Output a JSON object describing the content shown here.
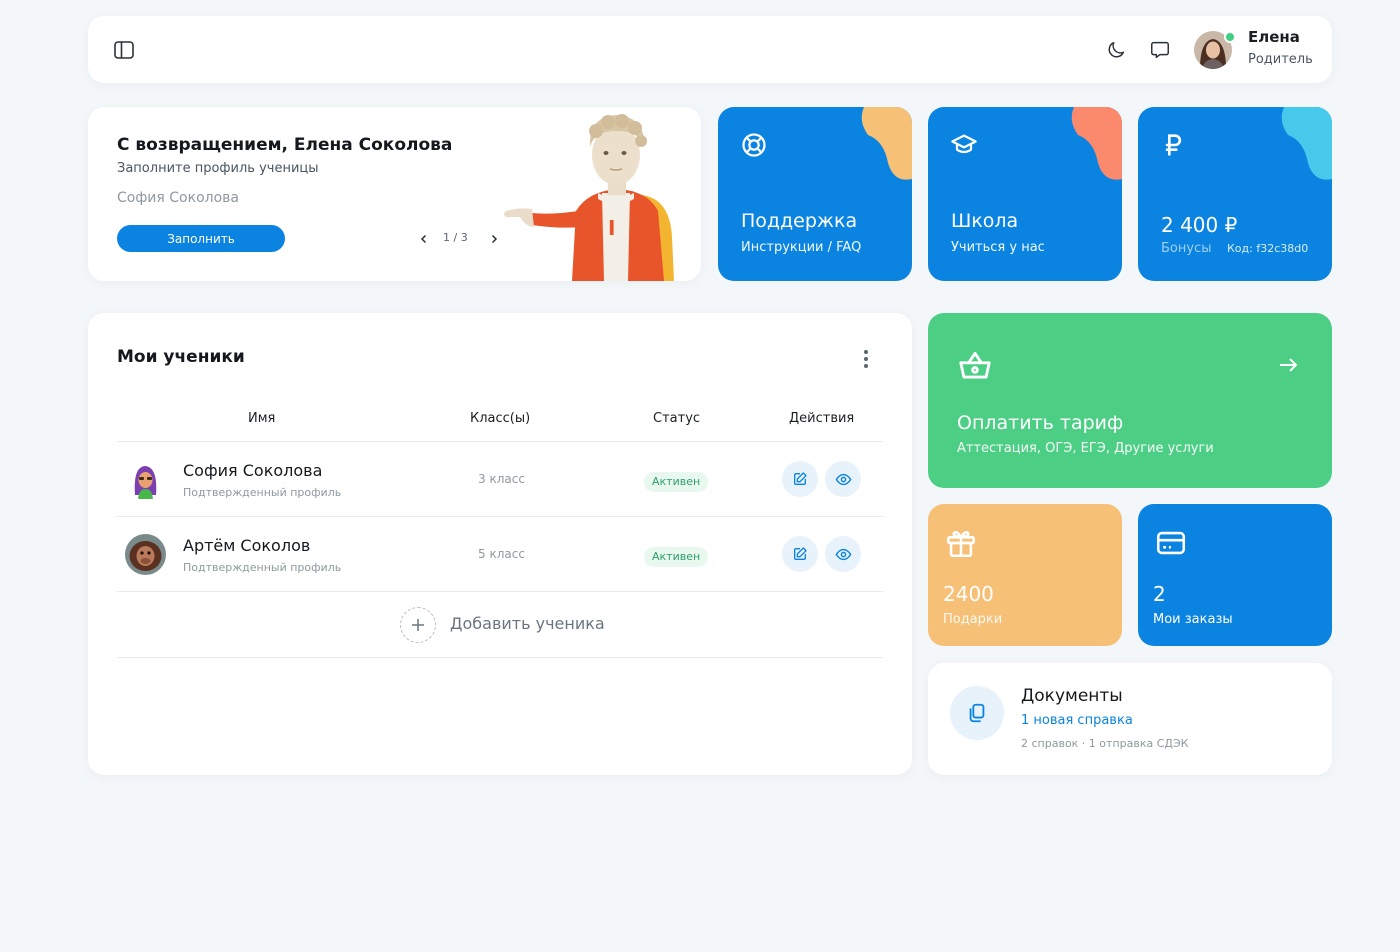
{
  "colors": {
    "primary": "#0a84e0",
    "green": "#4ccf84",
    "orange": "#f6c076",
    "online": "#3ecf7f"
  },
  "header": {
    "user_name": "Елена",
    "user_role": "Родитель",
    "icons": [
      "sidebar-toggle-icon",
      "moon-icon",
      "chat-icon"
    ]
  },
  "welcome": {
    "title": "С возвращением, Елена Соколова",
    "subtitle": "Заполните профиль ученицы",
    "student_name": "София Соколова",
    "fill_button": "Заполнить",
    "counter": "1 / 3"
  },
  "tiles": {
    "support": {
      "title": "Поддержка",
      "subtitle": "Инструкции / FAQ",
      "icon": "lifebuoy-icon"
    },
    "school": {
      "title": "Школа",
      "subtitle": "Учиться у нас",
      "icon": "graduation-cap-icon"
    },
    "bonus": {
      "amount": "2 400 ₽",
      "label": "Бонусы",
      "code": "Код: f32c38d0",
      "icon": "ruble-icon"
    }
  },
  "students": {
    "title": "Мои ученики",
    "columns": {
      "name": "Имя",
      "class": "Класс(ы)",
      "status": "Статус",
      "actions": "Действия"
    },
    "rows": [
      {
        "name": "София Соколова",
        "subtitle": "Подтвержденный профиль",
        "class": "3 класс",
        "status": "Активен"
      },
      {
        "name": "Артём Соколов",
        "subtitle": "Подтвержденный профиль",
        "class": "5 класс",
        "status": "Активен"
      }
    ],
    "add_label": "Добавить ученика"
  },
  "pay": {
    "title": "Оплатить тариф",
    "subtitle": "Аттестация, ОГЭ, ЕГЭ, Другие услуги",
    "icon": "basket-icon"
  },
  "gifts": {
    "value": "2400",
    "label": "Подарки",
    "icon": "gift-icon"
  },
  "orders": {
    "value": "2",
    "label": "Мои заказы",
    "icon": "credit-card-icon"
  },
  "documents": {
    "title": "Документы",
    "new_label": "1 новая справка",
    "meta": "2 справок · 1 отправка СДЭК",
    "icon": "documents-icon"
  }
}
